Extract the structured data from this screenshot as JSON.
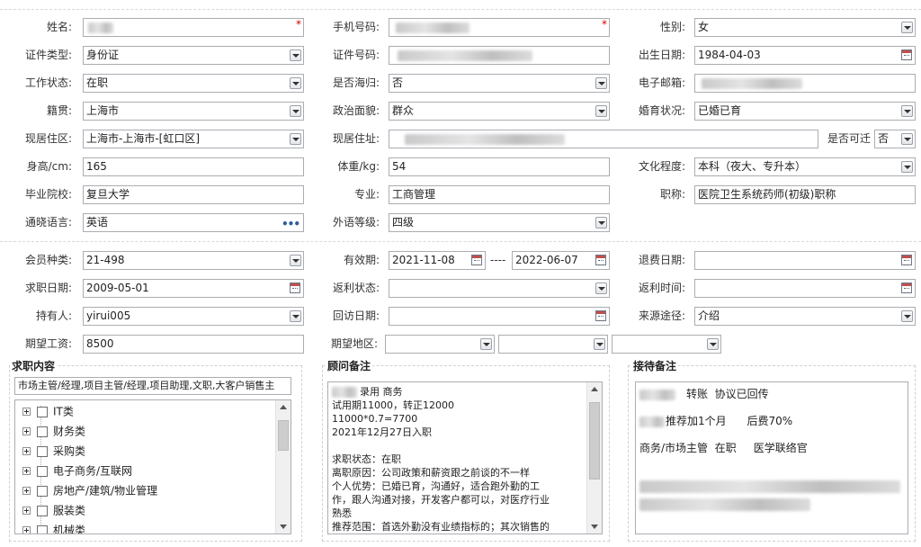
{
  "basic": {
    "name": {
      "label": "姓名:"
    },
    "mobile": {
      "label": "手机号码:"
    },
    "gender": {
      "label": "性别:",
      "value": "女"
    },
    "id_type": {
      "label": "证件类型:",
      "value": "身份证"
    },
    "id_no": {
      "label": "证件号码:"
    },
    "birth": {
      "label": "出生日期:",
      "value": "1984-04-03"
    },
    "work_status": {
      "label": "工作状态:",
      "value": "在职"
    },
    "overseas": {
      "label": "是否海归:",
      "value": "否"
    },
    "email": {
      "label": "电子邮箱:"
    },
    "native": {
      "label": "籍贯:",
      "value": "上海市"
    },
    "political": {
      "label": "政治面貌:",
      "value": "群众"
    },
    "marital": {
      "label": "婚育状况:",
      "value": "已婚已育"
    },
    "residence_area": {
      "label": "现居住区:",
      "value": "上海市-上海市-[虹口区]"
    },
    "address": {
      "label": "现居住址:"
    },
    "relocate": {
      "label": "是否可迁",
      "value": "否"
    },
    "height": {
      "label": "身高/cm:",
      "value": "165"
    },
    "weight": {
      "label": "体重/kg:",
      "value": "54"
    },
    "education": {
      "label": "文化程度:",
      "value": "本科（夜大、专升本）"
    },
    "school": {
      "label": "毕业院校:",
      "value": "复旦大学"
    },
    "major": {
      "label": "专业:",
      "value": "工商管理"
    },
    "title": {
      "label": "职称:",
      "value": "医院卫生系统药师(初级)职称"
    },
    "language": {
      "label": "通晓语言:",
      "value": "英语"
    },
    "lang_level": {
      "label": "外语等级:",
      "value": "四级"
    }
  },
  "member": {
    "type": {
      "label": "会员种类:",
      "value": "21-498"
    },
    "valid": {
      "label": "有效期:",
      "from": "2021-11-08",
      "sep": "----",
      "to": "2022-06-07"
    },
    "refund_date": {
      "label": "退费日期:",
      "value": ""
    },
    "job_date": {
      "label": "求职日期:",
      "value": "2009-05-01"
    },
    "rebate_status": {
      "label": "返利状态:",
      "value": ""
    },
    "rebate_time": {
      "label": "返利时间:",
      "value": ""
    },
    "holder": {
      "label": "持有人:",
      "value": "yirui005"
    },
    "visit_date": {
      "label": "回访日期:",
      "value": ""
    },
    "source": {
      "label": "来源途径:",
      "value": "介绍"
    },
    "salary": {
      "label": "期望工资:",
      "value": "8500"
    },
    "region": {
      "label": "期望地区:"
    }
  },
  "job_content": {
    "title": "求职内容",
    "selected": "市场主管/经理,项目主管/经理,项目助理,文职,大客户销售主",
    "tree": [
      "IT类",
      "财务类",
      "采购类",
      "电子商务/互联网",
      "房地产/建筑/物业管理",
      "服装类",
      "机械类"
    ]
  },
  "consultant_note": {
    "title": "顾问备注",
    "lines": [
      "录用 商务",
      "试用期11000，转正12000",
      "11000*0.7=7700",
      "2021年12月27日入职",
      "",
      "求职状态：在职",
      "离职原因：公司政策和薪资跟之前谈的不一样",
      "个人优势：已婚已育，沟通好，适合跑外勤的工",
      "作，跟人沟通对接，开发客户都可以，对医疗行业",
      "熟悉",
      "推荐范围：首选外勤没有业绩指标的；其次销售的"
    ]
  },
  "reception_note": {
    "title": "接待备注",
    "line1": "转账  协议已回传",
    "line2": "推荐加1个月      后费70%",
    "line3": "商务/市场主管  在职     医学联络官"
  }
}
